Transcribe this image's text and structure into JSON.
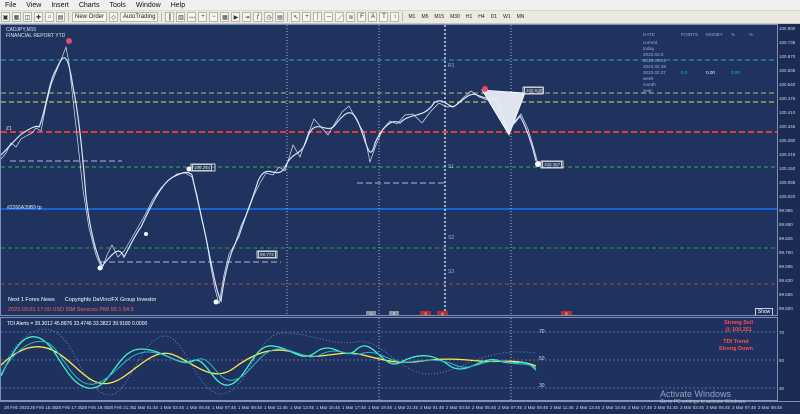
{
  "menu": [
    "File",
    "View",
    "Insert",
    "Charts",
    "Tools",
    "Window",
    "Help"
  ],
  "toolbar": {
    "new_order": "New Order",
    "autotrading": "AutoTrading",
    "timeframes": [
      "M1",
      "M5",
      "M15",
      "M30",
      "H1",
      "H4",
      "D1",
      "W1",
      "MN"
    ]
  },
  "chart": {
    "symbol_line1": "CADJPY,M15",
    "symbol_line2": "FINANCIAL REPORT YTD",
    "left_level": "#2266A39B9 tp",
    "main_label": "Z1",
    "date_label": "Copyrights DaVinciFX Group Investor",
    "news_title": "Next 1 Forex News",
    "news_red": "2023.03.01 17:00  USD ISM Services PMI     55.1     54.5",
    "show_button": "Show",
    "tdi_label": "TDI Alerts = 39.3012 45.8876 33.4746 33.3822 39.9180 0.0000",
    "strong_sell_1": "Strong Sell",
    "strong_sell_2": "@ 100.251",
    "tdi_trend_1": "TDI Trend",
    "tdi_trend_2": "Strong Down",
    "watermark_title": "Activate Windows",
    "watermark_sub": "Go to PC settings to activate Windows."
  },
  "price_axis": [
    "100.800",
    "100.735",
    "100.670",
    "100.605",
    "100.540",
    "100.475",
    "100.410",
    "100.345",
    "100.280",
    "100.215",
    "100.150",
    "100.085",
    "100.020",
    "99.955",
    "99.890",
    "99.825",
    "99.760",
    "99.695",
    "99.630",
    "99.565",
    "99.500"
  ],
  "subchart_axis": [
    "70",
    "50",
    "30"
  ],
  "time_axis": [
    "28 Feb 2023",
    "28 Feb 15:45",
    "28 Feb 17:45",
    "28 Feb 19:45",
    "28 Feb 21:45",
    "1 Mar 01:45",
    "1 Mar 03:45",
    "1 Mar 05:45",
    "1 Mar 07:45",
    "1 Mar 09:45",
    "1 Mar 11:45",
    "1 Mar 13:45",
    "1 Mar 15:45",
    "1 Mar 17:45",
    "1 Mar 19:45",
    "1 Mar 21:45",
    "2 Mar 01:45",
    "2 Mar 03:45",
    "2 Mar 05:45",
    "2 Mar 07:45",
    "2 Mar 09:45",
    "2 Mar 11:45",
    "2 Mar 13:45",
    "2 Mar 15:45",
    "2 Mar 17:45",
    "3 Mar 01:45",
    "3 Mar 03:45",
    "3 Mar 05:45",
    "3 Mar 07:45",
    "3 Mar 09:45",
    "3 Mar 11:45",
    "3 Mar 13:45"
  ],
  "table": {
    "headers": [
      "DATE",
      "POINTS",
      "MONEY",
      "%",
      "%"
    ],
    "rows": [
      [
        "current",
        "",
        "",
        "",
        ""
      ],
      [
        "today",
        "",
        "",
        "",
        ""
      ],
      [
        "2023.03.0",
        "",
        "",
        "",
        ""
      ],
      [
        "2023.03.01",
        "",
        "",
        "",
        ""
      ],
      [
        "2023.02.28",
        "",
        "",
        "",
        ""
      ],
      [
        "2023.02.27",
        "0.0",
        "0.00",
        "0.00",
        ""
      ],
      [
        "week",
        "",
        "",
        "",
        ""
      ],
      [
        "month",
        "",
        "",
        "",
        ""
      ],
      [
        "year",
        "",
        "",
        "",
        ""
      ]
    ]
  },
  "levels": {
    "s1": "S1",
    "r1": "R1",
    "s2": "S2",
    "s3": "S3",
    "box1": "100.214",
    "box2": "100.630",
    "box3": "99.774",
    "box4": "100.367"
  },
  "colors": {
    "background": "#20335f",
    "price_line": "#d8e3f6",
    "red_level": "#e03a3a",
    "green_level": "#39b35e",
    "blue_level": "#1473ff",
    "yellow_level": "#e5e64d",
    "cyan_level": "#1aa7bd",
    "teal_line": "#42f0c6",
    "yellow_line": "#ffe94a"
  }
}
